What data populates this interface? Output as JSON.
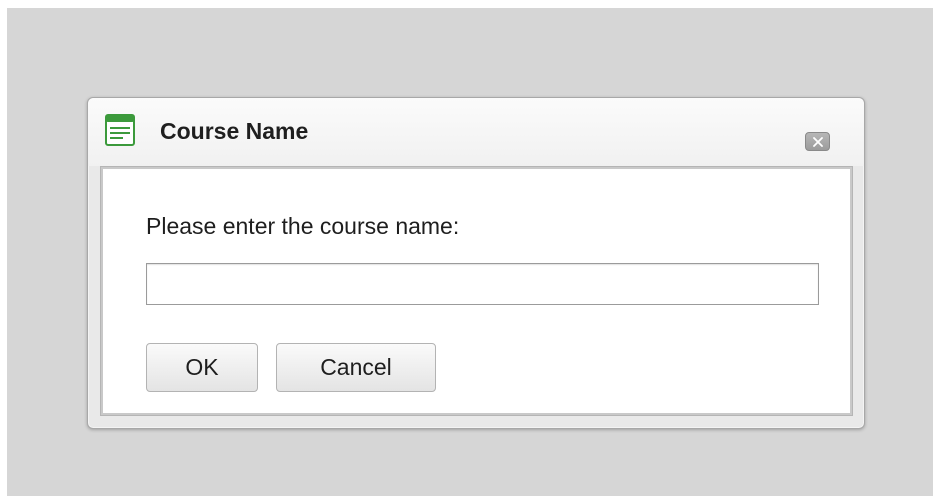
{
  "dialog": {
    "title": "Course Name",
    "icon": "window-form-icon",
    "close_icon": "close-icon",
    "prompt": "Please enter the course name:",
    "input": {
      "value": "",
      "placeholder": ""
    },
    "ok_label": "OK",
    "cancel_label": "Cancel"
  },
  "colors": {
    "backdrop": "#d6d6d6",
    "icon_accent": "#3c9a3c"
  }
}
